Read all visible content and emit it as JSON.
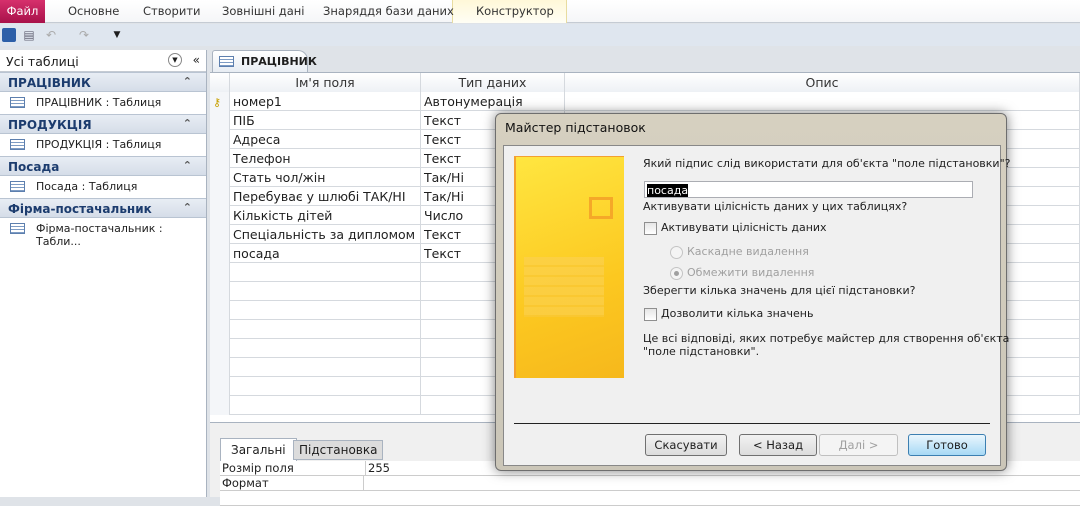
{
  "ribbon": {
    "file": "Файл",
    "tabs": [
      "Основне",
      "Створити",
      "Зовнішні дані",
      "Знаряддя бази даних",
      "Конструктор"
    ]
  },
  "nav": {
    "title": "Усі таблиці",
    "groups": [
      {
        "name": "ПРАЦІВНИК",
        "item": "ПРАЦІВНИК : Таблиця"
      },
      {
        "name": "ПРОДУКЦІЯ",
        "item": "ПРОДУКЦІЯ : Таблиця"
      },
      {
        "name": "Посада",
        "item": "Посада : Таблиця"
      },
      {
        "name": "Фірма-постачальник",
        "item": "Фірма-постачальник : Табли..."
      }
    ]
  },
  "doc": {
    "tab": "ПРАЦІВНИК",
    "headers": [
      "Ім'я поля",
      "Тип даних",
      "Опис"
    ],
    "rows": [
      {
        "name": "номер1",
        "type": "Автонумерація"
      },
      {
        "name": "ПІБ",
        "type": "Текст"
      },
      {
        "name": "Адреса",
        "type": "Текст"
      },
      {
        "name": "Телефон",
        "type": "Текст"
      },
      {
        "name": "Стать чол/жін",
        "type": "Так/Ні"
      },
      {
        "name": "Перебуває у шлюбі ТАК/НІ",
        "type": "Так/Ні"
      },
      {
        "name": "Кількість дітей",
        "type": "Число"
      },
      {
        "name": "Спеціальність за дипломом",
        "type": "Текст"
      },
      {
        "name": "посада",
        "type": "Текст"
      }
    ]
  },
  "props": {
    "tabs": [
      "Загальні",
      "Підстановка"
    ],
    "rows": [
      {
        "label": "Розмір поля",
        "value": "255"
      },
      {
        "label": "Формат",
        "value": ""
      }
    ]
  },
  "dialog": {
    "title": "Майстер підстановок",
    "q1": "Який підпис слід використати для об'єкта \"поле підстановки\"?",
    "label_value": "посада",
    "q2": "Активувати цілісність даних у цих таблицях?",
    "cb1": "Активувати цілісність даних",
    "r1": "Каскадне видалення",
    "r2": "Обмежити видалення",
    "q3": "Зберегти кілька значень для цієї підстановки?",
    "cb2": "Дозволити кілька значень",
    "info1": "Це всі відповіді, яких потребує майстер для створення об'єкта",
    "info2": "\"поле підстановки\".",
    "buttons": {
      "cancel": "Скасувати",
      "back": "< Назад",
      "next": "Далі >",
      "finish": "Готово"
    }
  }
}
